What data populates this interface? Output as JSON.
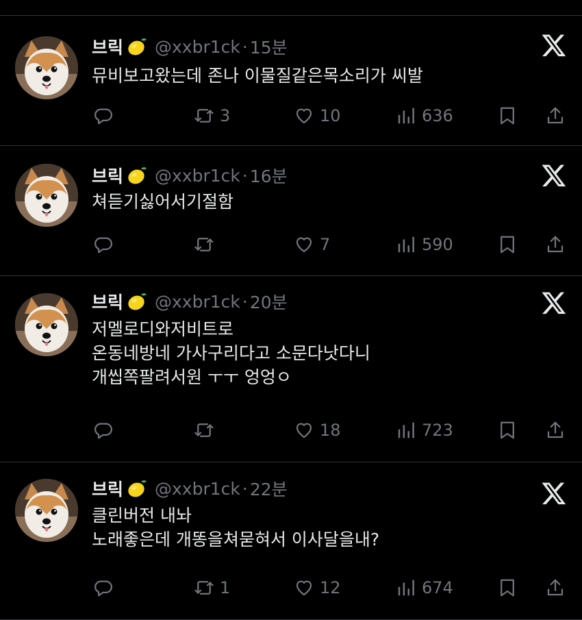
{
  "tweets": [
    {
      "name": "브릭",
      "emoji": "lemon-emoji",
      "handle": "@xxbr1ck",
      "separator": "·",
      "time": "15분",
      "lines": [
        "뮤비보고왔는데 존나 이물질같은목소리가 씨발"
      ],
      "reply_count": "",
      "retweet_count": "3",
      "like_count": "10",
      "view_count": "636"
    },
    {
      "name": "브릭",
      "emoji": "lemon-emoji",
      "handle": "@xxbr1ck",
      "separator": "·",
      "time": "16분",
      "lines": [
        "쳐듣기싫어서기절함"
      ],
      "reply_count": "",
      "retweet_count": "",
      "like_count": "7",
      "view_count": "590"
    },
    {
      "name": "브릭",
      "emoji": "lemon-emoji",
      "handle": "@xxbr1ck",
      "separator": "·",
      "time": "20분",
      "lines": [
        "저멜로디와저비트로",
        "온동네방네 가사구리다고 소문다낫다니",
        "개씹쪽팔려서원 ㅜㅜ 엉엉ㅇ"
      ],
      "reply_count": "",
      "retweet_count": "",
      "like_count": "18",
      "view_count": "723"
    },
    {
      "name": "브릭",
      "emoji": "lemon-emoji",
      "handle": "@xxbr1ck",
      "separator": "·",
      "time": "22분",
      "lines": [
        "클린버전 내놔",
        "노래좋은데 개똥을쳐묻혀서 이사달을내?"
      ],
      "reply_count": "",
      "retweet_count": "1",
      "like_count": "12",
      "view_count": "674"
    }
  ],
  "icons": {
    "brand": "x-logo-icon",
    "reply": "reply-icon",
    "retweet": "retweet-icon",
    "like": "heart-icon",
    "views": "views-icon",
    "bookmark": "bookmark-icon",
    "share": "share-icon"
  },
  "colors": {
    "background": "#000000",
    "text": "#e7e9ea",
    "secondary": "#71767b",
    "divider": "#2f3336"
  }
}
